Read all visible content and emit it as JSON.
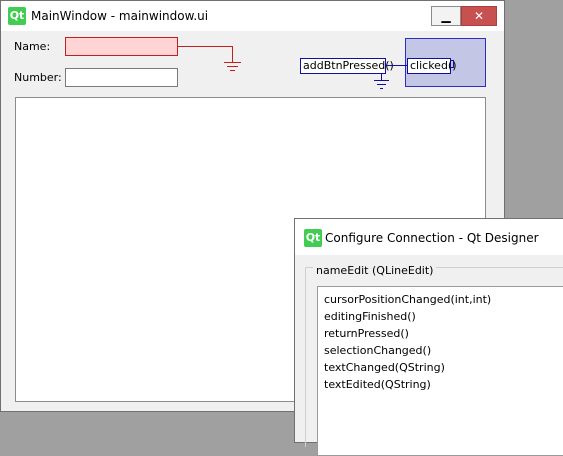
{
  "main_window": {
    "title": "MainWindow - mainwindow.ui",
    "logo_text": "Qt",
    "controls": {
      "minimize": "▁",
      "close": "✕"
    }
  },
  "form": {
    "name_label": "Name:",
    "name_value": "",
    "number_label": "Number:",
    "number_value": ""
  },
  "connection": {
    "slot": "addBtnPressed()",
    "signal": "clicked()"
  },
  "dialog": {
    "logo_text": "Qt",
    "title": "Configure Connection - Qt Designer",
    "group_title": "nameEdit (QLineEdit)",
    "signals": [
      "cursorPositionChanged(int,int)",
      "editingFinished()",
      "returnPressed()",
      "selectionChanged()",
      "textChanged(QString)",
      "textEdited(QString)"
    ]
  },
  "colors": {
    "broken_connection": "#c02020",
    "connection": "#1010a0",
    "selected_widget_fill": "#c4c6e6",
    "qt_green": "#41cd52"
  }
}
